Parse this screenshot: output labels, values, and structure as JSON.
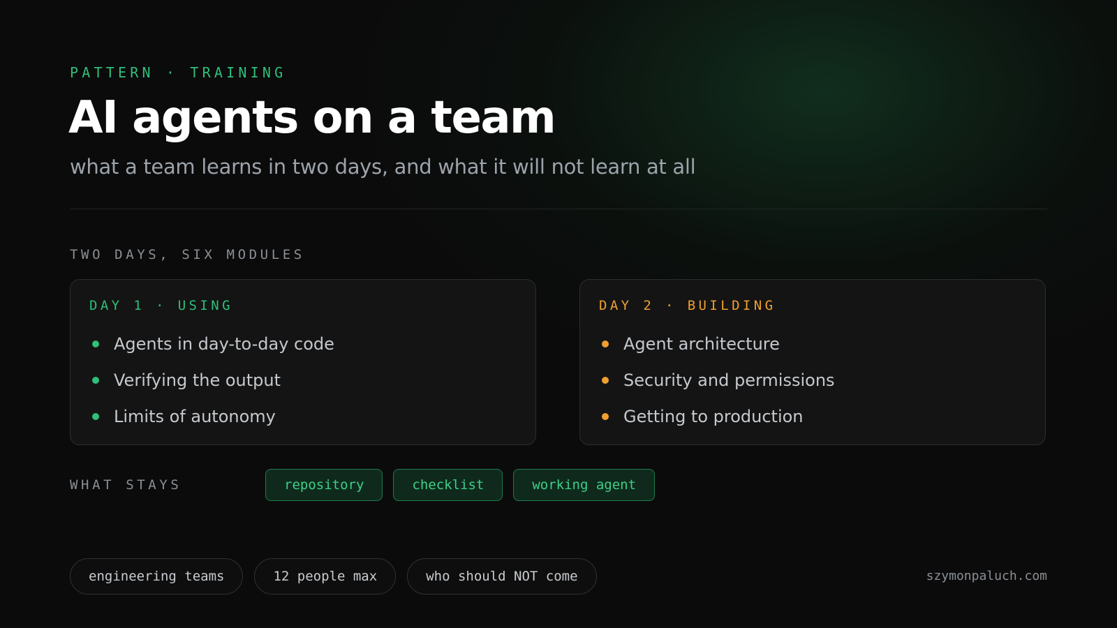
{
  "header": {
    "eyebrow": "PATTERN · TRAINING",
    "title": "AI agents on a team",
    "subtitle": "what a team learns in two days, and what it will not learn at all"
  },
  "modules": {
    "label": "TWO DAYS, SIX MODULES",
    "days": [
      {
        "label": "DAY 1 · USING",
        "accent": "#2fbf7a",
        "items": [
          "Agents in day-to-day code",
          "Verifying the output",
          "Limits of autonomy"
        ]
      },
      {
        "label": "DAY 2 · BUILDING",
        "accent": "#f0a030",
        "items": [
          "Agent architecture",
          "Security and permissions",
          "Getting to production"
        ]
      }
    ]
  },
  "stays": {
    "label": "WHAT STAYS",
    "chips": [
      "repository",
      "checklist",
      "working agent"
    ]
  },
  "footer": {
    "chips": [
      "engineering teams",
      "12 people max",
      "who should NOT come"
    ],
    "site": "szymonpaluch.com"
  },
  "colors": {
    "green_accent": "#2fbf7a",
    "orange_accent": "#f0a030",
    "background": "#0b0b0b"
  }
}
